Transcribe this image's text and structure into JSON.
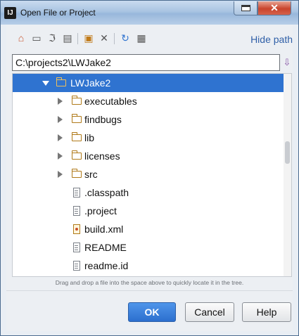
{
  "window": {
    "title": "Open File or Project",
    "app_icon_text": "IJ",
    "close_glyph": "✕"
  },
  "toolbar": {
    "hide_path_label": "Hide path",
    "icons": [
      "home-icon",
      "desktop-icon",
      "project-icon",
      "module-icon",
      "new-folder-icon",
      "delete-icon",
      "refresh-icon",
      "show-hidden-icon"
    ]
  },
  "path": {
    "value": "C:\\projects2\\LWJake2",
    "history_icon": "history-icon"
  },
  "tree": {
    "root": {
      "label": "LWJake2",
      "expanded": true,
      "selected": true
    },
    "folders": [
      {
        "label": "executables"
      },
      {
        "label": "findbugs"
      },
      {
        "label": "lib"
      },
      {
        "label": "licenses"
      },
      {
        "label": "src"
      }
    ],
    "files": [
      {
        "label": ".classpath",
        "icon": "text-file-icon"
      },
      {
        "label": ".project",
        "icon": "text-file-icon"
      },
      {
        "label": "build.xml",
        "icon": "ant-build-icon"
      },
      {
        "label": "README",
        "icon": "text-file-icon"
      },
      {
        "label": "readme.id",
        "icon": "text-file-icon"
      }
    ]
  },
  "hint": "Drag and drop a file into the space above to quickly locate it in the tree.",
  "buttons": {
    "ok": "OK",
    "cancel": "Cancel",
    "help": "Help"
  },
  "colors": {
    "selection": "#2f73d0",
    "link": "#2f5fa7",
    "ok_button": "#2c6fce"
  }
}
